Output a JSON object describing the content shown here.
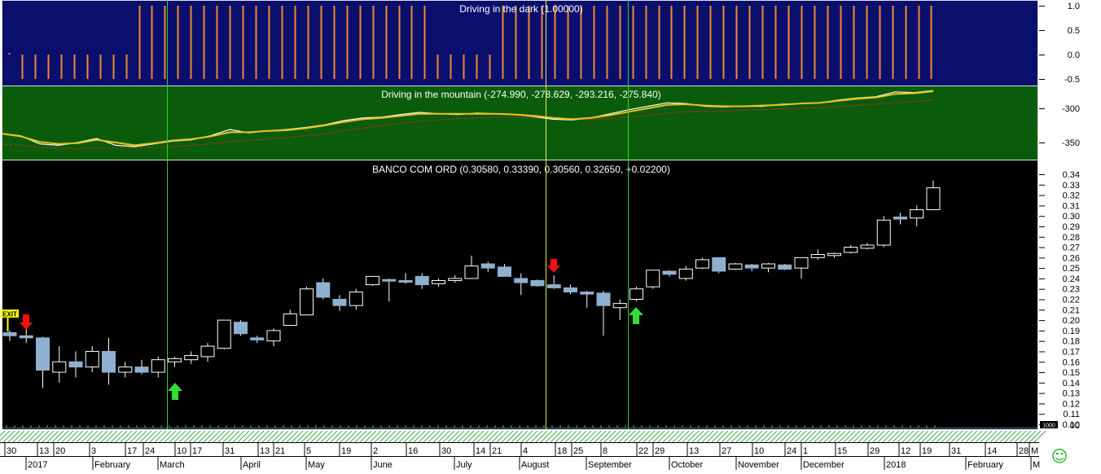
{
  "colors": {
    "top_bg": "#0a0f6e",
    "mid_bg": "#0a5c0a",
    "main_bg": "#000000",
    "panel_border": "#e0e0e0",
    "bar_orange": "#f08a28",
    "candle_up": "#000000",
    "candle_down": "#8fb0d0",
    "vline_green": "#33cc33",
    "vline_yellow": "#e8e84a",
    "line_white": "#ffffff",
    "line_yellow": "#f0c020",
    "line_red": "#cc2a2a",
    "arrow_red": "#ee1111",
    "arrow_green": "#33dd33",
    "exit_bg": "#ffff00"
  },
  "panels": {
    "top": {
      "title": "Driving in the dark (1.00000)",
      "ticks": [
        "1.0",
        "0.5",
        "0.0",
        "-0.5"
      ]
    },
    "mid": {
      "title": "Driving in the  mountain (-274.990, -278.629, -293.216, -275.840)",
      "ticks": [
        "-300",
        "-350"
      ]
    },
    "main": {
      "title": "BANCO COM ORD (0.30580, 0.33390, 0.30560, 0.32650, +0.02200)",
      "ticks": [
        "0.34",
        "0.33",
        "0.32",
        "0.31",
        "0.30",
        "0.29",
        "0.28",
        "0.27",
        "0.26",
        "0.25",
        "0.24",
        "0.23",
        "0.22",
        "0.21",
        "0.20",
        "0.19",
        "0.18",
        "0.17",
        "0.16",
        "0.15",
        "0.14",
        "0.13",
        "0.12",
        "0.11",
        "0.10"
      ],
      "volume_label": "1000",
      "zero_label": "00"
    }
  },
  "exit_label": "EXIT",
  "smile": "☺",
  "axis": {
    "days": [
      "30",
      "13",
      "20",
      "3",
      "17",
      "24",
      "10",
      "17",
      "31",
      "13",
      "21",
      "5",
      "19",
      "2",
      "16",
      "30",
      "14",
      "21",
      "4",
      "18",
      "25",
      "8",
      "22",
      "29",
      "13",
      "27",
      "10",
      "24",
      "1",
      "15",
      "29",
      "12",
      "19",
      "31",
      "14",
      "28",
      "M"
    ],
    "months": [
      "2017",
      "February",
      "March",
      "April",
      "May",
      "June",
      "July",
      "August",
      "September",
      "October",
      "November",
      "December",
      "2018",
      "February",
      "M"
    ]
  },
  "chart_data": [
    {
      "type": "bar",
      "title": "Driving in the dark (1.00000)",
      "ylim": [
        -0.6,
        1.1
      ],
      "values": [
        0,
        0,
        0,
        0,
        0,
        0,
        0,
        0,
        0,
        0,
        1,
        1,
        1,
        1,
        1,
        1,
        1,
        1,
        1,
        1,
        1,
        1,
        1,
        1,
        1,
        1,
        1,
        1,
        1,
        1,
        1,
        1,
        1,
        0,
        0,
        0,
        0,
        0,
        1,
        1,
        1,
        1,
        1,
        1,
        1,
        1,
        1,
        1,
        1,
        1,
        1,
        1,
        1,
        1,
        1,
        1,
        1,
        1,
        1,
        1,
        1,
        1,
        1,
        1,
        1,
        1,
        1,
        1,
        1,
        1,
        1,
        1,
        1
      ]
    },
    {
      "type": "line",
      "title": "Driving in the  mountain (-274.990, -278.629, -293.216, -275.840)",
      "ylim": [
        -375,
        -265
      ],
      "series": [
        {
          "values": [
            -337,
            -340,
            -352,
            -354,
            -350,
            -344,
            -354,
            -356,
            -352,
            -348,
            -346,
            -340,
            -331,
            -336,
            -333,
            -331,
            -328,
            -324,
            -318,
            -314,
            -313,
            -309,
            -306,
            -308,
            -309,
            -307,
            -308,
            -309,
            -312,
            -316,
            -317,
            -314,
            -308,
            -302,
            -297,
            -292,
            -293,
            -297,
            -298,
            -297,
            -297,
            -294,
            -293,
            -292,
            -288,
            -285,
            -283,
            -276,
            -277,
            -274
          ]
        },
        {
          "values": [
            -337,
            -341,
            -349,
            -352,
            -351,
            -346,
            -350,
            -354,
            -351,
            -347,
            -345,
            -341,
            -335,
            -335,
            -333,
            -332,
            -329,
            -325,
            -320,
            -316,
            -314,
            -311,
            -308,
            -308,
            -308,
            -308,
            -308,
            -309,
            -311,
            -314,
            -316,
            -314,
            -310,
            -305,
            -300,
            -295,
            -294,
            -296,
            -297,
            -297,
            -296,
            -295,
            -293,
            -292,
            -289,
            -286,
            -284,
            -279,
            -278,
            -275
          ]
        },
        {
          "values": [
            -352,
            -354,
            -357,
            -358,
            -359,
            -358,
            -358,
            -358,
            -357,
            -356,
            -354,
            -352,
            -349,
            -347,
            -345,
            -343,
            -340,
            -337,
            -333,
            -329,
            -325,
            -322,
            -319,
            -317,
            -315,
            -314,
            -313,
            -313,
            -314,
            -315,
            -316,
            -316,
            -315,
            -313,
            -310,
            -307,
            -305,
            -304,
            -304,
            -303,
            -302,
            -301,
            -300,
            -299,
            -298,
            -296,
            -294,
            -292,
            -290,
            -288
          ]
        }
      ]
    },
    {
      "type": "candlestick",
      "title": "BANCO COM ORD (0.30580, 0.33390, 0.30560, 0.32650, +0.02200)",
      "ylim": [
        0.1,
        0.345
      ],
      "candles": [
        [
          0.188,
          0.19,
          0.18,
          0.185
        ],
        [
          0.185,
          0.192,
          0.178,
          0.183
        ],
        [
          0.183,
          0.184,
          0.135,
          0.152
        ],
        [
          0.15,
          0.175,
          0.14,
          0.16
        ],
        [
          0.16,
          0.17,
          0.145,
          0.155
        ],
        [
          0.155,
          0.175,
          0.15,
          0.17
        ],
        [
          0.17,
          0.183,
          0.138,
          0.15
        ],
        [
          0.15,
          0.16,
          0.145,
          0.155
        ],
        [
          0.155,
          0.162,
          0.148,
          0.15
        ],
        [
          0.15,
          0.165,
          0.145,
          0.162
        ],
        [
          0.16,
          0.165,
          0.155,
          0.163
        ],
        [
          0.162,
          0.17,
          0.158,
          0.166
        ],
        [
          0.165,
          0.178,
          0.16,
          0.175
        ],
        [
          0.173,
          0.2,
          0.172,
          0.2
        ],
        [
          0.198,
          0.2,
          0.185,
          0.187
        ],
        [
          0.183,
          0.185,
          0.178,
          0.181
        ],
        [
          0.18,
          0.192,
          0.175,
          0.19
        ],
        [
          0.195,
          0.21,
          0.195,
          0.206
        ],
        [
          0.205,
          0.232,
          0.205,
          0.23
        ],
        [
          0.236,
          0.24,
          0.22,
          0.222
        ],
        [
          0.22,
          0.224,
          0.209,
          0.214
        ],
        [
          0.214,
          0.23,
          0.21,
          0.227
        ],
        [
          0.234,
          0.242,
          0.233,
          0.242
        ],
        [
          0.239,
          0.24,
          0.218,
          0.238
        ],
        [
          0.238,
          0.245,
          0.235,
          0.237
        ],
        [
          0.242,
          0.245,
          0.23,
          0.234
        ],
        [
          0.235,
          0.24,
          0.232,
          0.238
        ],
        [
          0.238,
          0.243,
          0.236,
          0.24
        ],
        [
          0.24,
          0.262,
          0.24,
          0.252
        ],
        [
          0.254,
          0.256,
          0.246,
          0.25
        ],
        [
          0.251,
          0.254,
          0.242,
          0.242
        ],
        [
          0.24,
          0.245,
          0.224,
          0.236
        ],
        [
          0.238,
          0.239,
          0.232,
          0.233
        ],
        [
          0.234,
          0.243,
          0.23,
          0.231
        ],
        [
          0.231,
          0.234,
          0.225,
          0.227
        ],
        [
          0.227,
          0.228,
          0.212,
          0.225
        ],
        [
          0.226,
          0.228,
          0.185,
          0.214
        ],
        [
          0.212,
          0.22,
          0.2,
          0.216
        ],
        [
          0.22,
          0.232,
          0.218,
          0.23
        ],
        [
          0.232,
          0.248,
          0.23,
          0.248
        ],
        [
          0.247,
          0.248,
          0.242,
          0.244
        ],
        [
          0.24,
          0.252,
          0.238,
          0.249
        ],
        [
          0.25,
          0.26,
          0.249,
          0.258
        ],
        [
          0.26,
          0.26,
          0.245,
          0.247
        ],
        [
          0.249,
          0.255,
          0.248,
          0.254
        ],
        [
          0.253,
          0.254,
          0.247,
          0.25
        ],
        [
          0.25,
          0.255,
          0.246,
          0.254
        ],
        [
          0.253,
          0.254,
          0.248,
          0.249
        ],
        [
          0.25,
          0.26,
          0.24,
          0.26
        ],
        [
          0.26,
          0.268,
          0.258,
          0.263
        ],
        [
          0.262,
          0.265,
          0.26,
          0.264
        ],
        [
          0.265,
          0.272,
          0.264,
          0.27
        ],
        [
          0.269,
          0.274,
          0.268,
          0.272
        ],
        [
          0.272,
          0.3,
          0.27,
          0.296
        ],
        [
          0.299,
          0.303,
          0.292,
          0.297
        ],
        [
          0.298,
          0.31,
          0.29,
          0.306
        ],
        [
          0.306,
          0.334,
          0.306,
          0.327
        ]
      ]
    }
  ]
}
